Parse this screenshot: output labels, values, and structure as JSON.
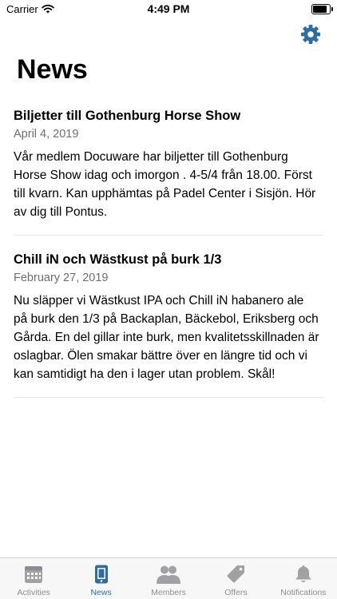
{
  "status_bar": {
    "carrier": "Carrier",
    "time": "4:49 PM"
  },
  "colors": {
    "accent": "#2e6da4",
    "inactive": "#a0a0a5",
    "separator": "#e5e5ea"
  },
  "header": {
    "title": "News",
    "settings_icon": "gear-icon"
  },
  "news": [
    {
      "title": "Biljetter till Gothenburg Horse Show",
      "date": "April 4, 2019",
      "body": "Vår medlem Docuware har biljetter till Gothenburg Horse Show idag och imorgon . 4-5/4 från 18.00. Först till kvarn. Kan upphämtas på Padel Center i Sisjön. Hör av dig till Pontus."
    },
    {
      "title": "Chill iN och Wästkust på burk 1/3",
      "date": "February 27, 2019",
      "body": "Nu släpper vi Wästkust IPA och Chill iN habanero ale på burk den 1/3 på Backaplan, Bäckebol, Eriksberg och Gårda. En del gillar inte burk, men kvalitetsskillnaden är oslagbar. Ölen smakar bättre över en längre tid och vi kan samtidigt ha den i lager utan problem. Skål!"
    }
  ],
  "tabs": [
    {
      "label": "Activities",
      "icon": "calendar-icon",
      "active": false
    },
    {
      "label": "News",
      "icon": "news-icon",
      "active": true
    },
    {
      "label": "Members",
      "icon": "members-icon",
      "active": false
    },
    {
      "label": "Offers",
      "icon": "tag-icon",
      "active": false
    },
    {
      "label": "Notifications",
      "icon": "bell-icon",
      "active": false
    }
  ]
}
